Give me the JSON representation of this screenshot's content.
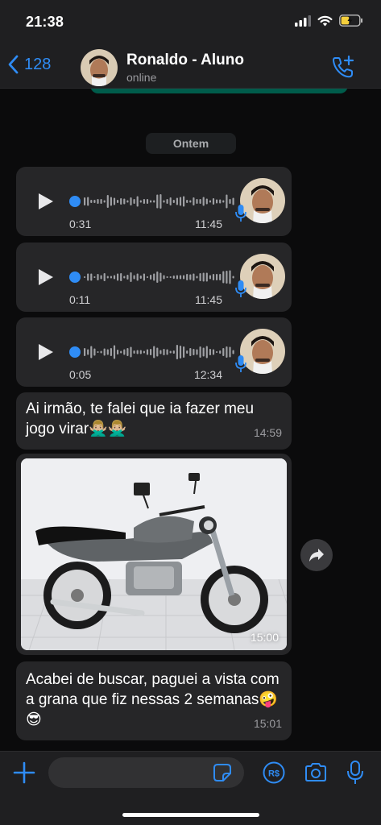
{
  "status_bar": {
    "time": "21:38",
    "battery_level": 0.45
  },
  "header": {
    "back_count": "128",
    "contact_name": "Ronaldo - Aluno",
    "contact_status": "online",
    "icons": {
      "back": "chevron-left-icon",
      "call": "call-add-icon"
    }
  },
  "chat": {
    "date_separator": "Ontem",
    "voice_messages": [
      {
        "duration": "0:31",
        "time": "11:45"
      },
      {
        "duration": "0:11",
        "time": "11:45"
      },
      {
        "duration": "0:05",
        "time": "12:34"
      }
    ],
    "text_message_1": {
      "text": "Ai irmão, te falei que ia fazer meu jogo virar🙅🏼‍♂️🙅🏼‍♂️",
      "time": "14:59"
    },
    "photo_message": {
      "time": "15:00",
      "subject": "motorcycle photo"
    },
    "text_message_2": {
      "text": "Acabei de buscar, paguei a vista com a grana que fiz nessas 2 semanas🤪😎",
      "time": "15:01"
    }
  },
  "input_bar": {
    "placeholder": "",
    "icons": [
      "plus-icon",
      "sticker-icon",
      "payment-icon",
      "camera-icon",
      "microphone-icon"
    ]
  },
  "colors": {
    "accent": "#2f8cf5",
    "bubble": "#262628",
    "background": "#0b0b0c",
    "bar": "#1f1f21"
  }
}
